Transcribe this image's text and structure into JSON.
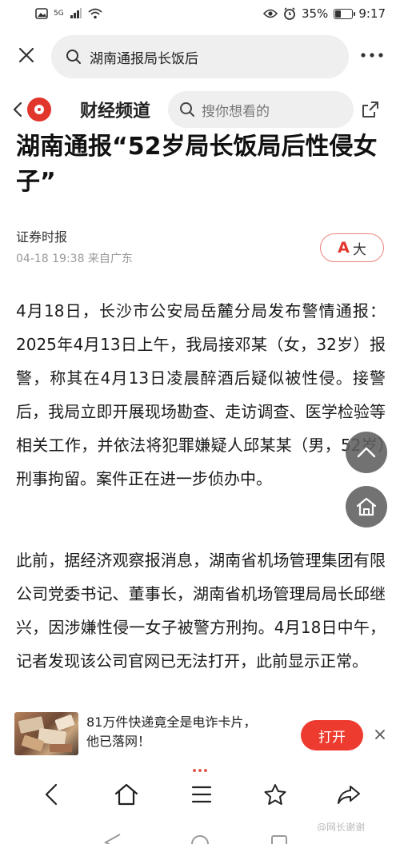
{
  "status_bar": {
    "network": "5G",
    "battery": "35%",
    "battery_level": 0.35,
    "time": "9:17"
  },
  "browser": {
    "url_query": "湖南通报局长饭后",
    "icons": {
      "close": "close-icon",
      "search": "search-icon",
      "more": "more-icon"
    }
  },
  "site": {
    "channel": "财经频道",
    "search_placeholder": "搜你想看的",
    "brand_color": "#e2352c"
  },
  "article": {
    "title": "湖南通报“52岁局长饭局后性侵女子”",
    "source": "证券时报",
    "meta": "04-18 19:38 来自广东",
    "font_button": {
      "a": "A",
      "label": "大"
    },
    "paragraphs": [
      "4月18日，长沙市公安局岳麓分局发布警情通报：2025年4月13日上午，我局接邓某（女，32岁）报警，称其在4月13日凌晨醉酒后疑似被性侵。接警后，我局立即开展现场勘查、走访调查、医学检验等相关工作，并依法将犯罪嫌疑人邱某某（男，52岁）刑事拘留。案件正在进一步侦办中。",
      "此前，据经济观察报消息，湖南省机场管理集团有限公司党委书记、董事长，湖南省机场管理局局长邱继兴，因涉嫌性侵一女子被警方刑拘。4月18日中午，记者发现该公司官网已无法打开，此前显示正常。"
    ]
  },
  "ad": {
    "text_line1": "81万件快递竟全是电诈卡片，",
    "text_line2": "他已落网！",
    "open_label": "打开",
    "accent": "#ee3b2f"
  },
  "toolbar": {
    "icons": [
      "back-icon",
      "home-icon",
      "menu-icon",
      "star-icon",
      "share-icon"
    ]
  },
  "watermark": "@网长谢谢"
}
